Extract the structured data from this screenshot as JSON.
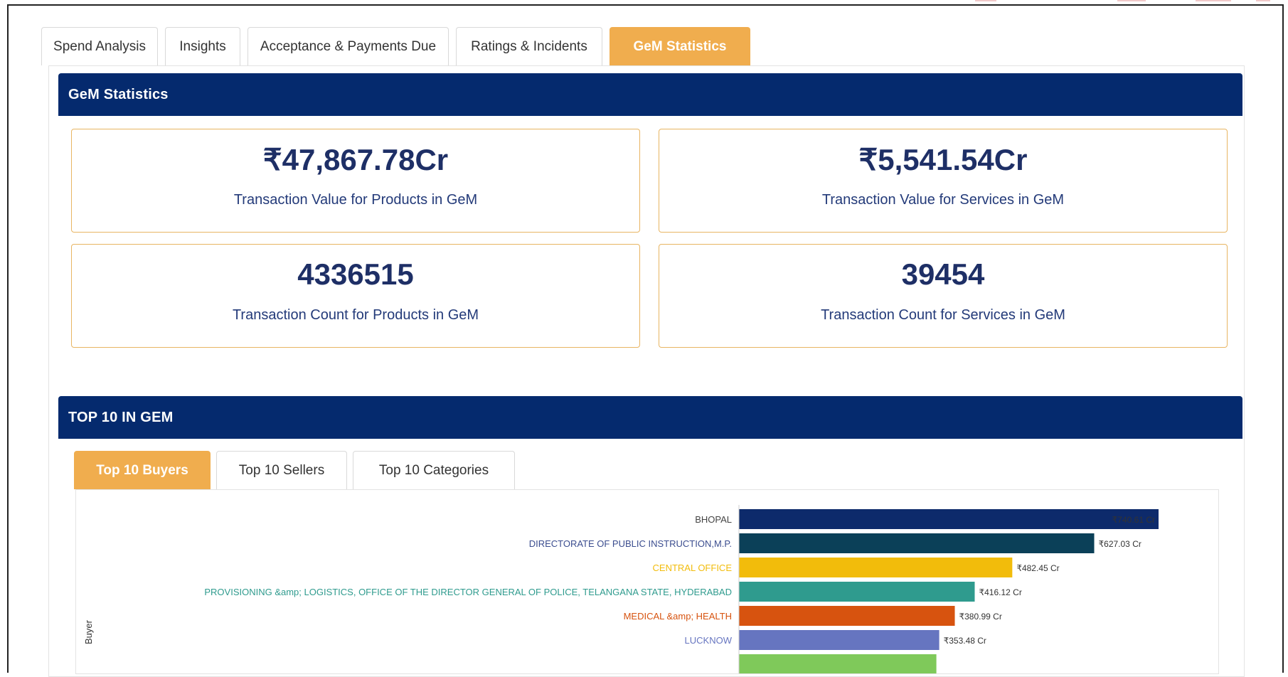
{
  "tabs": [
    {
      "label": "Spend Analysis"
    },
    {
      "label": "Insights"
    },
    {
      "label": "Acceptance & Payments Due"
    },
    {
      "label": "Ratings & Incidents"
    },
    {
      "label": "GeM Statistics",
      "active": true
    }
  ],
  "stats_panel": {
    "title": "GeM Statistics",
    "cards": [
      {
        "value": "₹47,867.78Cr",
        "label": "Transaction Value for Products in GeM"
      },
      {
        "value": "₹5,541.54Cr",
        "label": "Transaction Value for Services in GeM"
      },
      {
        "value": "4336515",
        "label": "Transaction Count for Products in GeM"
      },
      {
        "value": "39454",
        "label": "Transaction Count for Services in GeM"
      }
    ]
  },
  "top10_panel": {
    "title": "TOP 10 IN GEM",
    "subtabs": [
      {
        "label": "Top 10 Buyers",
        "active": true
      },
      {
        "label": "Top 10 Sellers"
      },
      {
        "label": "Top 10 Categories"
      }
    ]
  },
  "chart_data": {
    "type": "bar",
    "orientation": "horizontal",
    "ylabel": "Buyer",
    "categories": [
      "BHOPAL",
      "DIRECTORATE OF PUBLIC INSTRUCTION,M.P.",
      "CENTRAL OFFICE",
      "PROVISIONING &amp; LOGISTICS, OFFICE OF THE DIRECTOR GENERAL OF POLICE, TELANGANA STATE, HYDERABAD",
      "MEDICAL &amp; HEALTH",
      "LUCKNOW"
    ],
    "values": [
      740.61,
      627.03,
      482.45,
      416.12,
      380.99,
      353.48
    ],
    "value_labels": [
      "₹740.61 Cr",
      "₹627.03 Cr",
      "₹482.45 Cr",
      "₹416.12 Cr",
      "₹380.99 Cr",
      "₹353.48 Cr"
    ],
    "bar_colors": [
      "#0d2a6b",
      "#0b4058",
      "#f2bc0b",
      "#2f9b8e",
      "#d7530f",
      "#6675c0"
    ],
    "label_colors": [
      "#444444",
      "#3b4d8f",
      "#f2bc0b",
      "#2f9b8e",
      "#d7530f",
      "#6675c0"
    ],
    "partial_next_bar_color": "#7fc95a"
  }
}
